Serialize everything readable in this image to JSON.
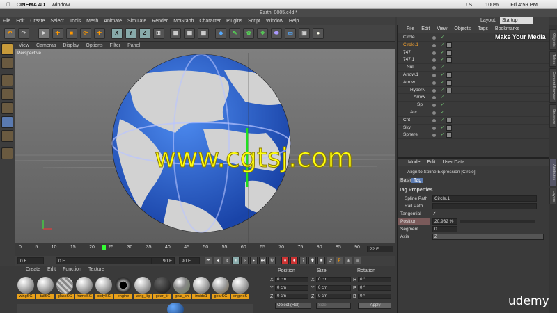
{
  "mac": {
    "apple": "",
    "app": "CINEMA 4D",
    "window_menu": "Window",
    "flag": "U.S.",
    "battery": "100%",
    "time": "Fri 4:59 PM"
  },
  "window": {
    "title": "Earth_0005.c4d *"
  },
  "menu": [
    "File",
    "Edit",
    "Create",
    "Select",
    "Tools",
    "Mesh",
    "Animate",
    "Simulate",
    "Render",
    "MoGraph",
    "Character",
    "Plugins",
    "Script",
    "Window",
    "Help"
  ],
  "layout": {
    "label": "Layout:",
    "value": "Startup"
  },
  "viewport": {
    "menu": [
      "View",
      "Cameras",
      "Display",
      "Options",
      "Filter",
      "Panel"
    ],
    "label": "Perspective"
  },
  "timeline": {
    "ticks": [
      "0",
      "5",
      "10",
      "15",
      "20",
      "25",
      "30",
      "35",
      "40",
      "45",
      "50",
      "55",
      "60",
      "65",
      "70",
      "75",
      "80",
      "85",
      "90"
    ],
    "end_frame": "22 F",
    "current": "0 F",
    "start": "0 F",
    "max1": "90 F",
    "max2": "90 F"
  },
  "materials": {
    "menu": [
      "Create",
      "Edit",
      "Function",
      "Texture"
    ],
    "items": [
      "wingSG",
      "tailSG",
      "glassSG",
      "frameSG",
      "bodySG",
      "engine",
      "wing_lig",
      "gear_tir",
      "gear_ch",
      "inside1",
      "gearSG",
      "engineS"
    ]
  },
  "coords": {
    "headers": [
      "Position",
      "Size",
      "Rotation"
    ],
    "rows": [
      {
        "a": "X",
        "pos": "0 cm",
        "b": "X",
        "size": "0 cm",
        "c": "H",
        "rot": "0 °"
      },
      {
        "a": "Y",
        "pos": "0 cm",
        "b": "Y",
        "size": "0 cm",
        "c": "P",
        "rot": "0 °"
      },
      {
        "a": "Z",
        "pos": "0 cm",
        "b": "Z",
        "size": "0 cm",
        "c": "B",
        "rot": "0 °"
      }
    ],
    "mode": "Object (Rel)",
    "size_mode": "Size",
    "apply": "Apply"
  },
  "objects": {
    "menu": [
      "File",
      "Edit",
      "View",
      "Objects",
      "Tags",
      "Bookmarks"
    ],
    "rows": [
      {
        "name": "Circle",
        "sel": false
      },
      {
        "name": "Circle.1",
        "sel": true
      },
      {
        "name": "747",
        "sel": false
      },
      {
        "name": "747.1",
        "sel": false
      },
      {
        "name": "Null",
        "sel": false
      },
      {
        "name": "Arrow.1",
        "sel": false
      },
      {
        "name": "Arrow",
        "sel": false
      },
      {
        "name": "HyperN",
        "sel": false
      },
      {
        "name": "Arrow",
        "sel": false
      },
      {
        "name": "Sp",
        "sel": false
      },
      {
        "name": "Arc",
        "sel": false
      },
      {
        "name": "Cnt",
        "sel": false
      },
      {
        "name": "Sky",
        "sel": false
      },
      {
        "name": "Sphere",
        "sel": false
      }
    ]
  },
  "attributes": {
    "menu": [
      "Mode",
      "Edit",
      "User Data"
    ],
    "title": "Align to Spline Expression [Circle]",
    "tabs": [
      "Basic",
      "Tag"
    ],
    "section": "Tag Properties",
    "fields": [
      {
        "label": "Spline Path",
        "value": "Circle.1"
      },
      {
        "label": "Rail Path",
        "value": ""
      },
      {
        "label": "Tangential",
        "value": "✓"
      },
      {
        "label": "Position",
        "value": "20.932 %"
      },
      {
        "label": "Segment",
        "value": "0"
      },
      {
        "label": "Axis",
        "value": "Z"
      }
    ]
  },
  "side_tabs": [
    "Objects",
    "Takes",
    "Content Browser",
    "Structure",
    "Attributes",
    "Layers"
  ],
  "overlay": {
    "watermark": "www.cgtsj.com",
    "brand": "udemy",
    "make_media": "Make Your Media"
  },
  "colors": {
    "accent": "#f0a030",
    "globe_blue": "#2a64d8",
    "watermark": "#ffff10"
  }
}
